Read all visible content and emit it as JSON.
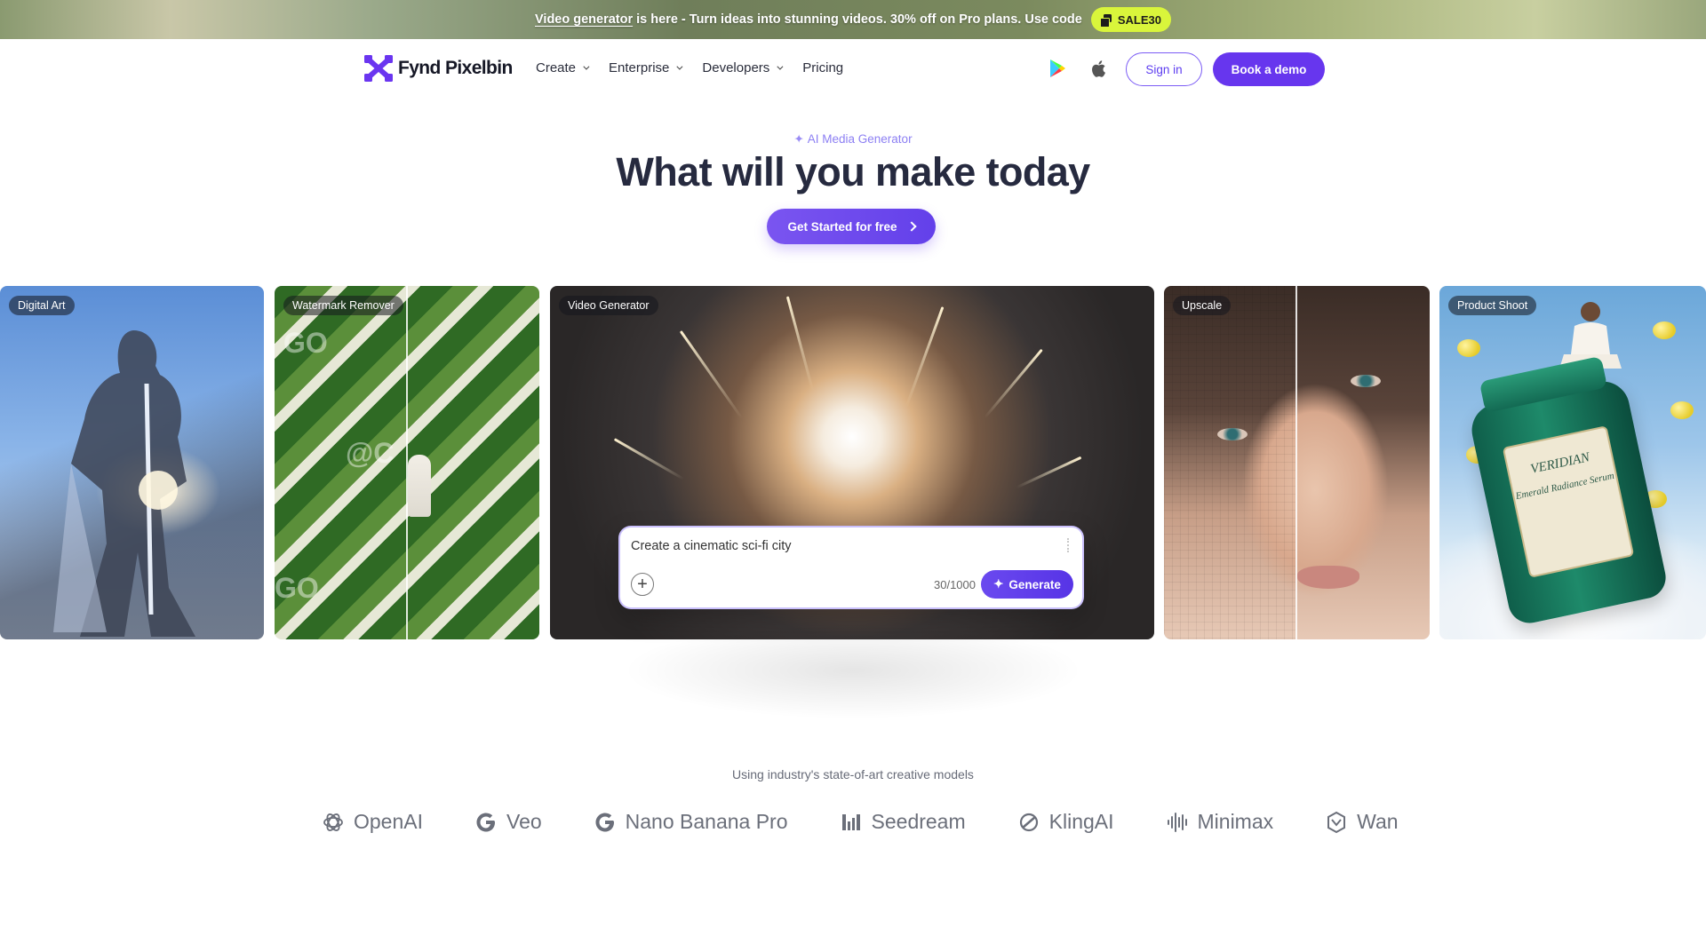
{
  "promo": {
    "link_text": "Video generator",
    "text": "is here - Turn ideas into stunning videos. 30% off on Pro plans. Use code",
    "code": "SALE30"
  },
  "nav": {
    "brand": "Fynd Pixelbin",
    "menu": [
      {
        "label": "Create",
        "has_dropdown": true
      },
      {
        "label": "Enterprise",
        "has_dropdown": true
      },
      {
        "label": "Developers",
        "has_dropdown": true
      },
      {
        "label": "Pricing",
        "has_dropdown": false
      }
    ],
    "store_icons": [
      "google-play-icon",
      "apple-icon"
    ],
    "sign_in": "Sign in",
    "book_demo": "Book a demo"
  },
  "hero": {
    "eyebrow": "AI Media Generator",
    "title": "What will you make today",
    "cta": "Get Started for free"
  },
  "cards": [
    {
      "tag": "Digital Art"
    },
    {
      "tag": "Watermark Remover"
    },
    {
      "tag": "Video Generator"
    },
    {
      "tag": "Upscale"
    },
    {
      "tag": "Product Shoot"
    }
  ],
  "prompt": {
    "value": "Create a cinematic sci-fi city",
    "count": "30/1000",
    "generate": "Generate"
  },
  "product_label": "VERIDIAN",
  "product_sublabel": "Emerald Radiance Serum",
  "models": {
    "caption": "Using industry's state-of-art creative models",
    "items": [
      {
        "name": "OpenAI",
        "icon": "openai-icon"
      },
      {
        "name": "Veo",
        "icon": "google-g-icon"
      },
      {
        "name": "Nano Banana Pro",
        "icon": "google-g-icon"
      },
      {
        "name": "Seedream",
        "icon": "seedream-bars-icon"
      },
      {
        "name": "KlingAI",
        "icon": "klingai-icon"
      },
      {
        "name": "Minimax",
        "icon": "minimax-wave-icon"
      },
      {
        "name": "Wan",
        "icon": "wan-icon"
      }
    ]
  },
  "colors": {
    "brand_purple": "#6736ee",
    "promo_code_bg": "#d9f53b",
    "logo_purple": "#6a35f0"
  }
}
